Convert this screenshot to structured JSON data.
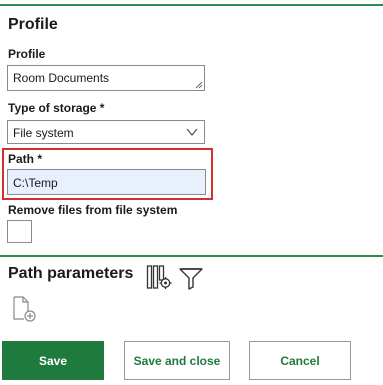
{
  "profile_section": {
    "title": "Profile",
    "profile_field": {
      "label": "Profile",
      "value": "Room Documents"
    },
    "storage_field": {
      "label": "Type of storage *",
      "value": "File system"
    },
    "path_field": {
      "label": "Path *",
      "value": "C:\\Temp"
    },
    "remove_files_field": {
      "label": "Remove files from file system",
      "checked": false
    }
  },
  "path_parameters_section": {
    "title": "Path parameters",
    "icons": [
      "columns-settings-icon",
      "filter-icon",
      "add-document-icon"
    ]
  },
  "buttons": {
    "save": "Save",
    "save_close": "Save and close",
    "cancel": "Cancel"
  },
  "colors": {
    "accent_green": "#1f7a3e",
    "error_red": "#d32f2f",
    "autofill_bg": "#e8f0fe"
  }
}
